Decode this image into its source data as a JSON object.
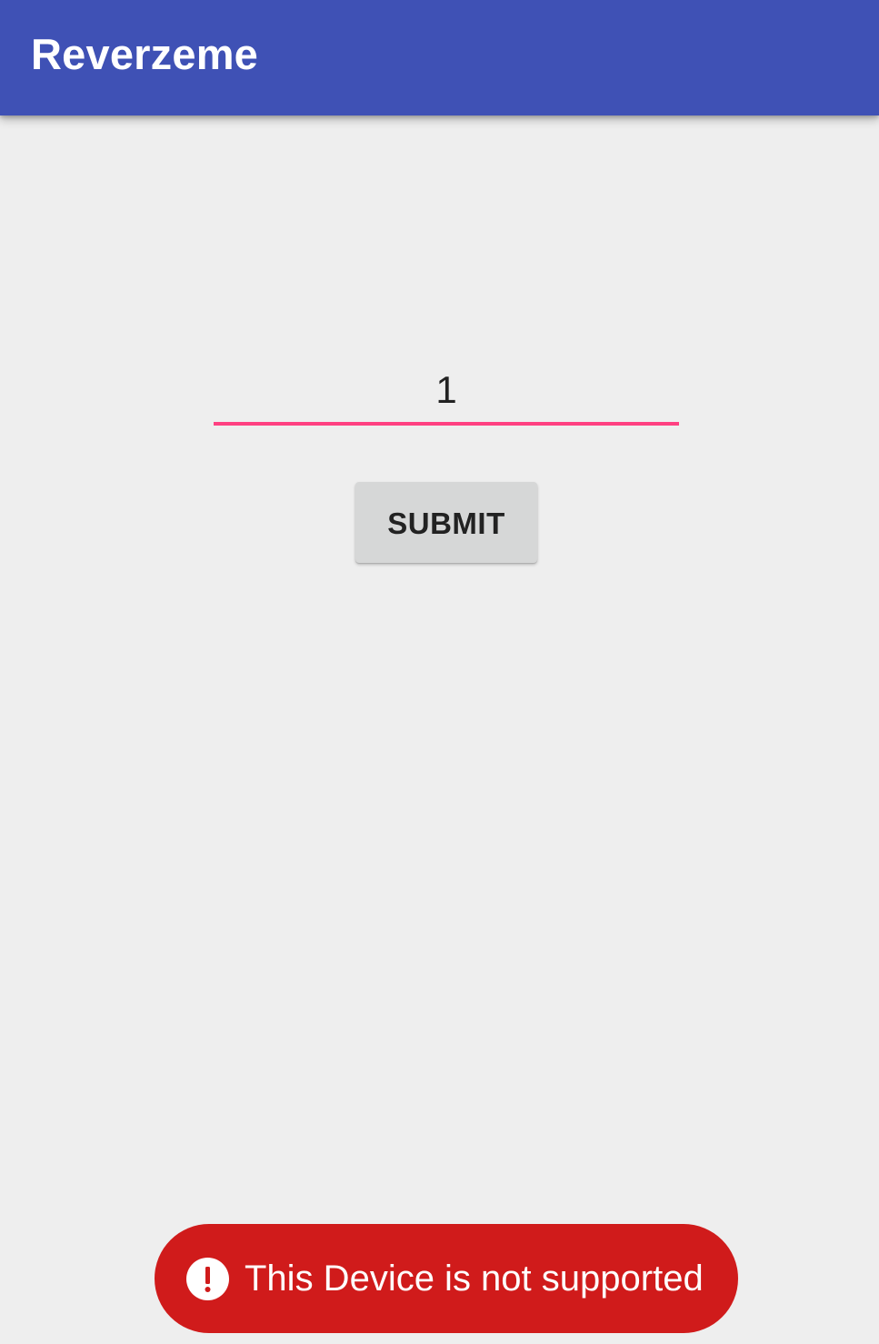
{
  "app_bar": {
    "title": "Reverzeme",
    "color": "#3f51b5"
  },
  "form": {
    "input_value": "1",
    "underline_color": "#ff4081",
    "submit_label": "SUBMIT"
  },
  "toast": {
    "icon": "alert-circle-icon",
    "message": "This Device is not supported",
    "color": "#d01b1b"
  },
  "background_color": "#eeeeee"
}
